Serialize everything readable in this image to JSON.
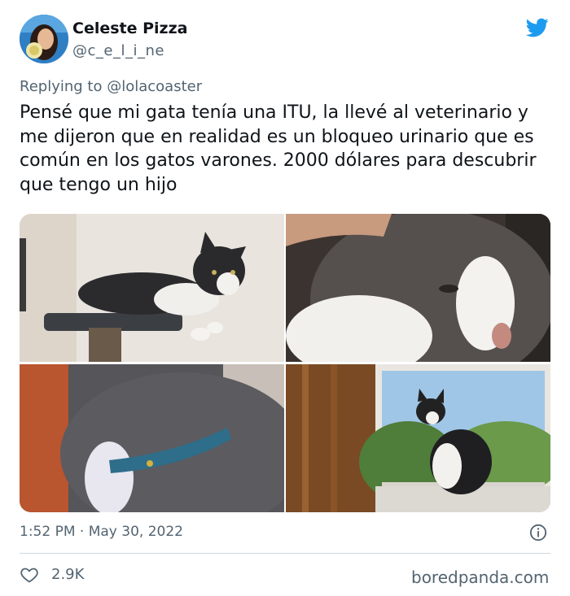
{
  "author": {
    "name": "Celeste Pizza",
    "handle": "@c_e_l_i_ne"
  },
  "reply": {
    "prefix": "Replying to ",
    "to": "@lolacoaster"
  },
  "tweet": {
    "text": "Pensé que mi gata tenía una ITU, la llevé al veterinario y me dijeron que en realidad es un bloqueo urinario que es común en los gatos varones. 2000 dólares para descubrir que tengo un hijo"
  },
  "photos": [
    {
      "icon": "cat-on-shelf-photo"
    },
    {
      "icon": "cat-face-closeup-photo"
    },
    {
      "icon": "cat-collar-closeup-photo"
    },
    {
      "icon": "cat-by-window-photo"
    }
  ],
  "meta": {
    "timestamp": "1:52 PM · May 30, 2022",
    "likes": "2.9K"
  },
  "footer": {
    "credit": "boredpanda.com"
  },
  "colors": {
    "twitter_blue": "#1d9bf0",
    "muted": "#536471",
    "text": "#0f1419",
    "divider": "#cfd9de"
  }
}
